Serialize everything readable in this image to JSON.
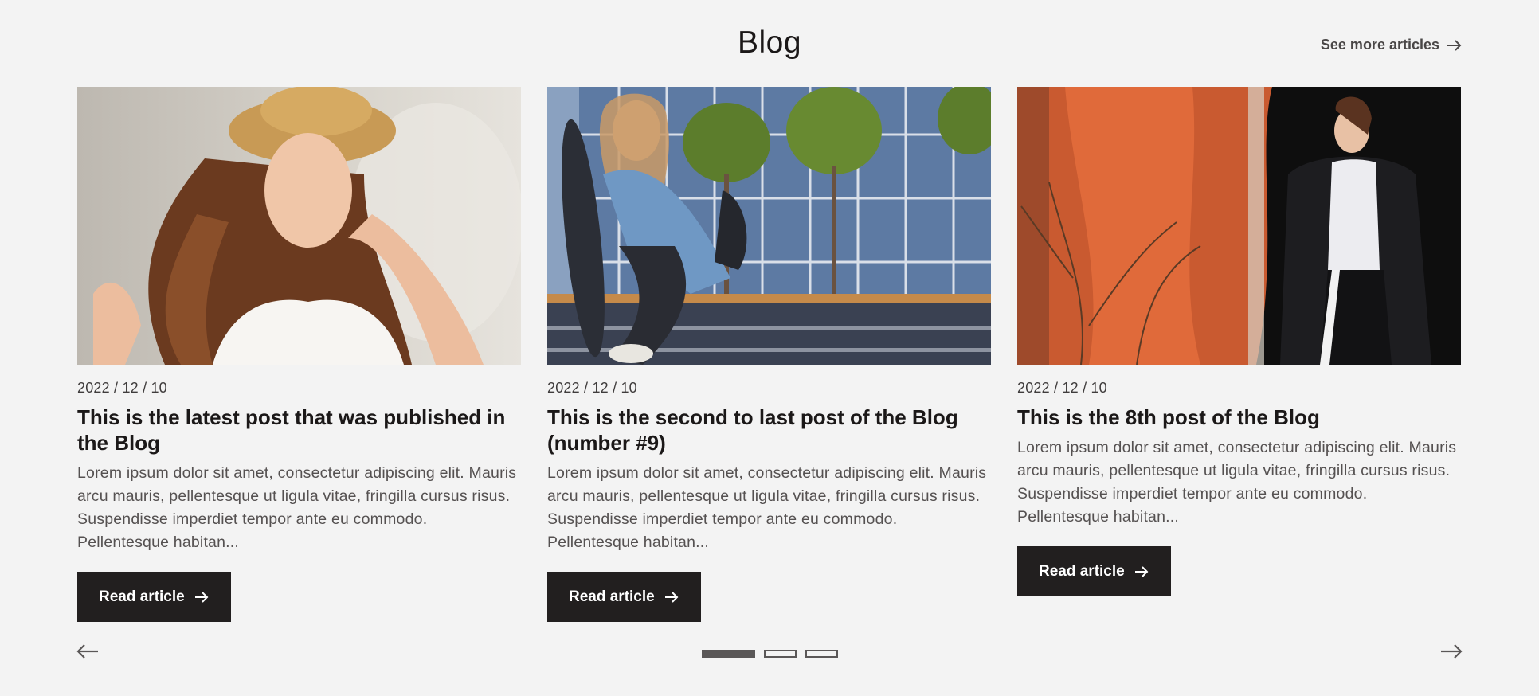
{
  "header": {
    "title": "Blog",
    "see_more_label": "See more articles"
  },
  "posts": [
    {
      "date": "2022 / 12 / 10",
      "title": "This is the latest post that was published in the Blog",
      "excerpt": "Lorem ipsum dolor sit amet, consectetur adipiscing elit. Mauris arcu mauris, pellentesque ut ligula vitae, fringilla cursus risus. Suspendisse imperdiet tempor ante eu commodo. Pellentesque habitan...",
      "button_label": "Read article"
    },
    {
      "date": "2022 / 12 / 10",
      "title": "This is the second to last post of the Blog (number #9)",
      "excerpt": "Lorem ipsum dolor sit amet, consectetur adipiscing elit. Mauris arcu mauris, pellentesque ut ligula vitae, fringilla cursus risus. Suspendisse imperdiet tempor ante eu commodo. Pellentesque habitan...",
      "button_label": "Read article"
    },
    {
      "date": "2022 / 12 / 10",
      "title": "This is the 8th post of the Blog",
      "excerpt": "Lorem ipsum dolor sit amet, consectetur adipiscing elit. Mauris arcu mauris, pellentesque ut ligula vitae, fringilla cursus risus. Suspendisse imperdiet tempor ante eu commodo. Pellentesque habitan...",
      "button_label": "Read article"
    }
  ],
  "carousel": {
    "active_page": 1,
    "page_count": 3,
    "prev_icon": "arrow-left-icon",
    "next_icon": "arrow-right-icon"
  },
  "colors": {
    "background": "#f3f3f3",
    "button": "#221f1f",
    "text": "#1b1818"
  }
}
